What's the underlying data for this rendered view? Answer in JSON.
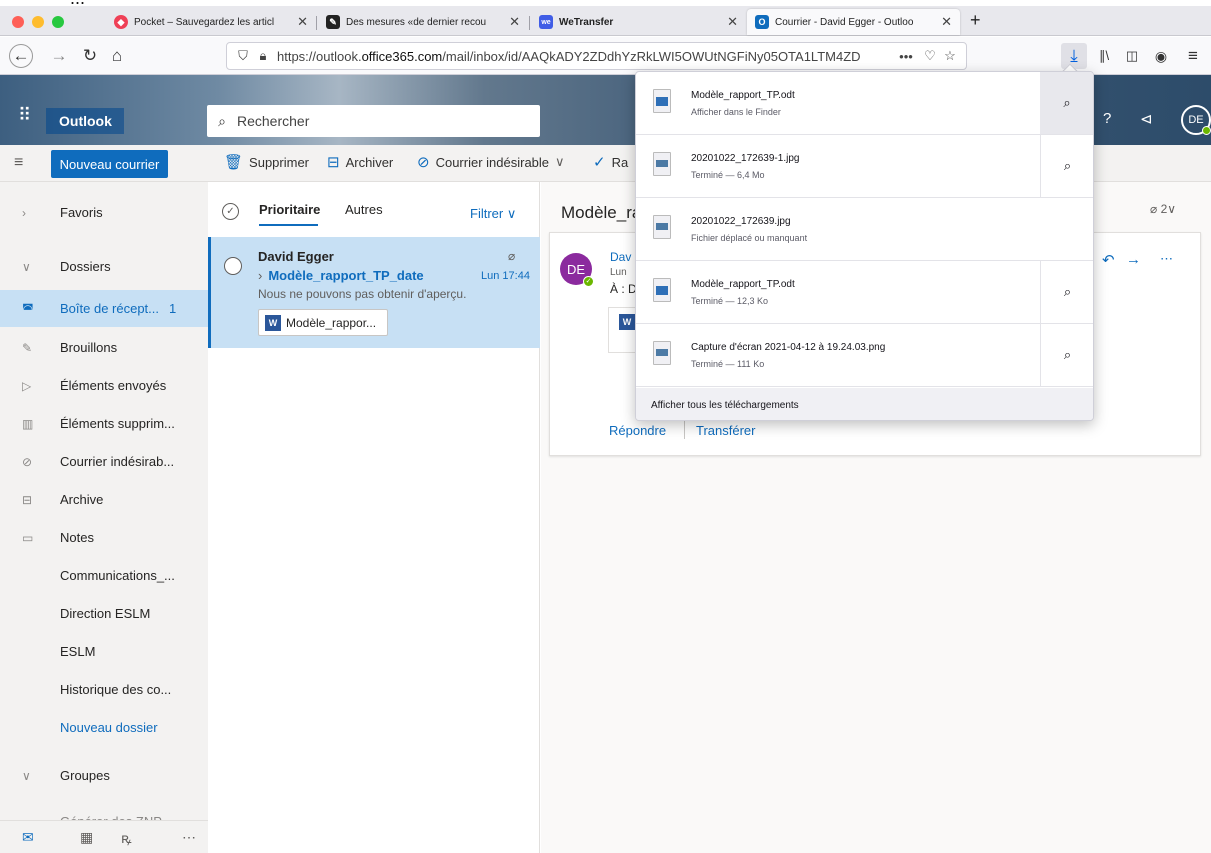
{
  "tabs": [
    {
      "title": "Pocket – Sauvegardez les articl",
      "close": "✕"
    },
    {
      "title": "Des mesures «de dernier recou",
      "close": "✕"
    },
    {
      "title": "WeTransfer",
      "close": "✕"
    },
    {
      "title": "Courrier - David Egger - Outloo",
      "close": "✕"
    }
  ],
  "new_tab": "+",
  "url": {
    "prefix": "https://outlook.",
    "domain": "office365.com",
    "path": "/mail/inbox/id/AAQkADY2ZDdhYzRkLWI5OWUtNGFiNy05OTA1LTM4ZD",
    "more": "•••"
  },
  "outlook": {
    "app_name": "Outlook",
    "search_placeholder": "Rechercher",
    "avatar_initials": "DE",
    "help": "?"
  },
  "toolbar": {
    "new_mail": "Nouveau courrier",
    "delete": "Supprimer",
    "archive": "Archiver",
    "junk": "Courrier indésirable",
    "chevron": "∨",
    "sweep": "Ra"
  },
  "nav": {
    "favorites": "Favoris",
    "folders": "Dossiers",
    "items": [
      {
        "label": "Boîte de récept...",
        "count": "1",
        "icon": "inbox-icon"
      },
      {
        "label": "Brouillons",
        "icon": "draft-icon"
      },
      {
        "label": "Éléments envoyés",
        "icon": "send-icon"
      },
      {
        "label": "Éléments supprim...",
        "icon": "trash-icon"
      },
      {
        "label": "Courrier indésirab...",
        "icon": "junk-icon"
      },
      {
        "label": "Archive",
        "icon": "archive-icon"
      },
      {
        "label": "Notes",
        "icon": "notes-icon"
      },
      {
        "label": "Communications_..."
      },
      {
        "label": "Direction ESLM"
      },
      {
        "label": "ESLM"
      },
      {
        "label": "Historique des co..."
      }
    ],
    "new_folder": "Nouveau dossier",
    "groups": "Groupes",
    "cut_off": "Générer des ZNP"
  },
  "list": {
    "tab_focused": "Prioritaire",
    "tab_other": "Autres",
    "filter": "Filtrer",
    "message": {
      "sender": "David Egger",
      "subject": "Modèle_rapport_TP_date",
      "date": "Lun 17:44",
      "preview": "Nous ne pouvons pas obtenir d'aperçu.",
      "attachment": "Modèle_rappor..."
    }
  },
  "reading": {
    "subject": "Modèle_ra",
    "count": "2",
    "avatar": "DE",
    "sender": "Dav",
    "date": "Lun",
    "to": "À : D",
    "reply": "Répondre",
    "forward": "Transférer"
  },
  "downloads": {
    "items": [
      {
        "name": "Modèle_rapport_TP.odt",
        "status": "Afficher dans le Finder",
        "type": "odt"
      },
      {
        "name": "20201022_172639-1.jpg",
        "status": "Terminé — 6,4 Mo",
        "type": "jpg"
      },
      {
        "name": "20201022_172639.jpg",
        "status": "Fichier déplacé ou manquant",
        "type": "jpg"
      },
      {
        "name": "Modèle_rapport_TP.odt",
        "status": "Terminé — 12,3 Ko",
        "type": "odt"
      },
      {
        "name": "Capture d'écran 2021-04-12 à 19.24.03.png",
        "status": "Terminé — 111 Ko",
        "type": "png"
      }
    ],
    "show_all": "Afficher tous les téléchargements"
  },
  "colors": {
    "accent": "#0f6cbd",
    "selected": "#c7e0f4",
    "avatar_purple": "#8b2a9e",
    "presence": "#6bb700"
  }
}
